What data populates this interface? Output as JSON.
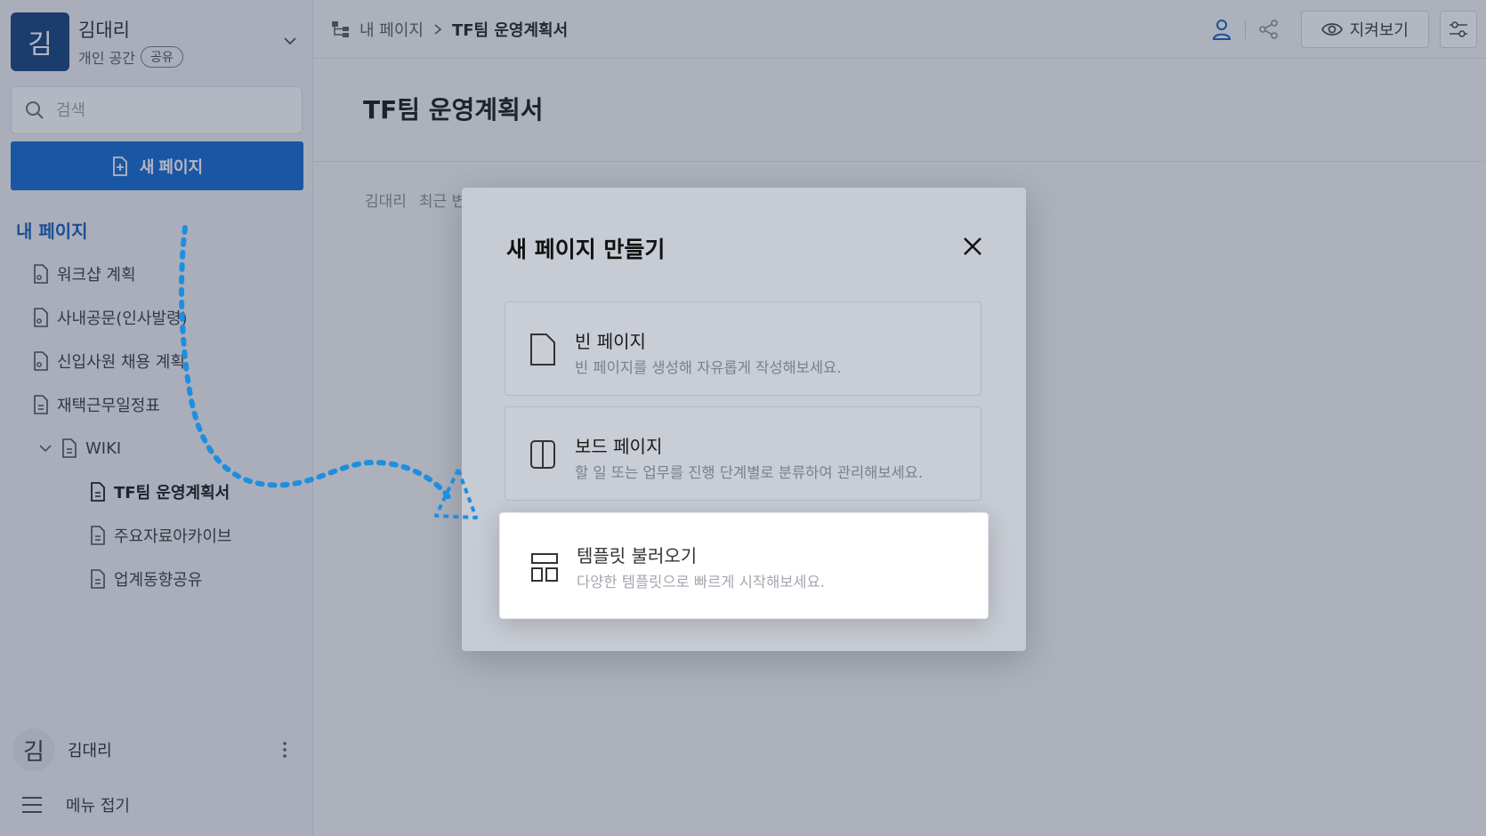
{
  "workspace": {
    "avatar_letter": "김",
    "name": "김대리",
    "subtitle": "개인 공간",
    "badge": "공유"
  },
  "search": {
    "placeholder": "검색"
  },
  "sidebar": {
    "new_page_label": "새 페이지",
    "section_title": "내 페이지",
    "tree": [
      {
        "label": "워크샵 계획",
        "icon": "shared-doc-icon"
      },
      {
        "label": "사내공문(인사발령)",
        "icon": "shared-doc-icon"
      },
      {
        "label": "신입사원 채용 계획",
        "icon": "shared-doc-icon"
      },
      {
        "label": "재택근무일정표",
        "icon": "doc-icon"
      },
      {
        "label": "WIKI",
        "icon": "doc-icon"
      },
      {
        "label": "TF팀 운영계획서",
        "icon": "doc-icon"
      },
      {
        "label": "주요자료아카이브",
        "icon": "doc-icon"
      },
      {
        "label": "업계동향공유",
        "icon": "doc-icon"
      }
    ],
    "profile": {
      "avatar_letter": "김",
      "name": "김대리"
    },
    "collapse_label": "메뉴 접기"
  },
  "topbar": {
    "breadcrumb_root": "내 페이지",
    "breadcrumb_current": "TF팀 운영계획서",
    "watch_label": "지켜보기"
  },
  "document": {
    "title": "TF팀 운영계획서",
    "meta_author": "김대리",
    "meta_recent": "최근 변"
  },
  "modal": {
    "title": "새 페이지 만들기",
    "options": [
      {
        "title": "빈 페이지",
        "desc": "빈 페이지를 생성해 자유롭게 작성해보세요."
      },
      {
        "title": "보드 페이지",
        "desc": "할 일 또는 업무를 진행 단계별로 분류하여 관리해보세요."
      },
      {
        "title": "템플릿 불러오기",
        "desc": "다양한 템플릿으로 빠르게 시작해보세요."
      }
    ]
  },
  "colors": {
    "primary": "#0a63d1",
    "workspace_avatar": "#0b3a7a",
    "section_title": "#0a57b8",
    "annotation_arrow": "#1e8fe0"
  }
}
